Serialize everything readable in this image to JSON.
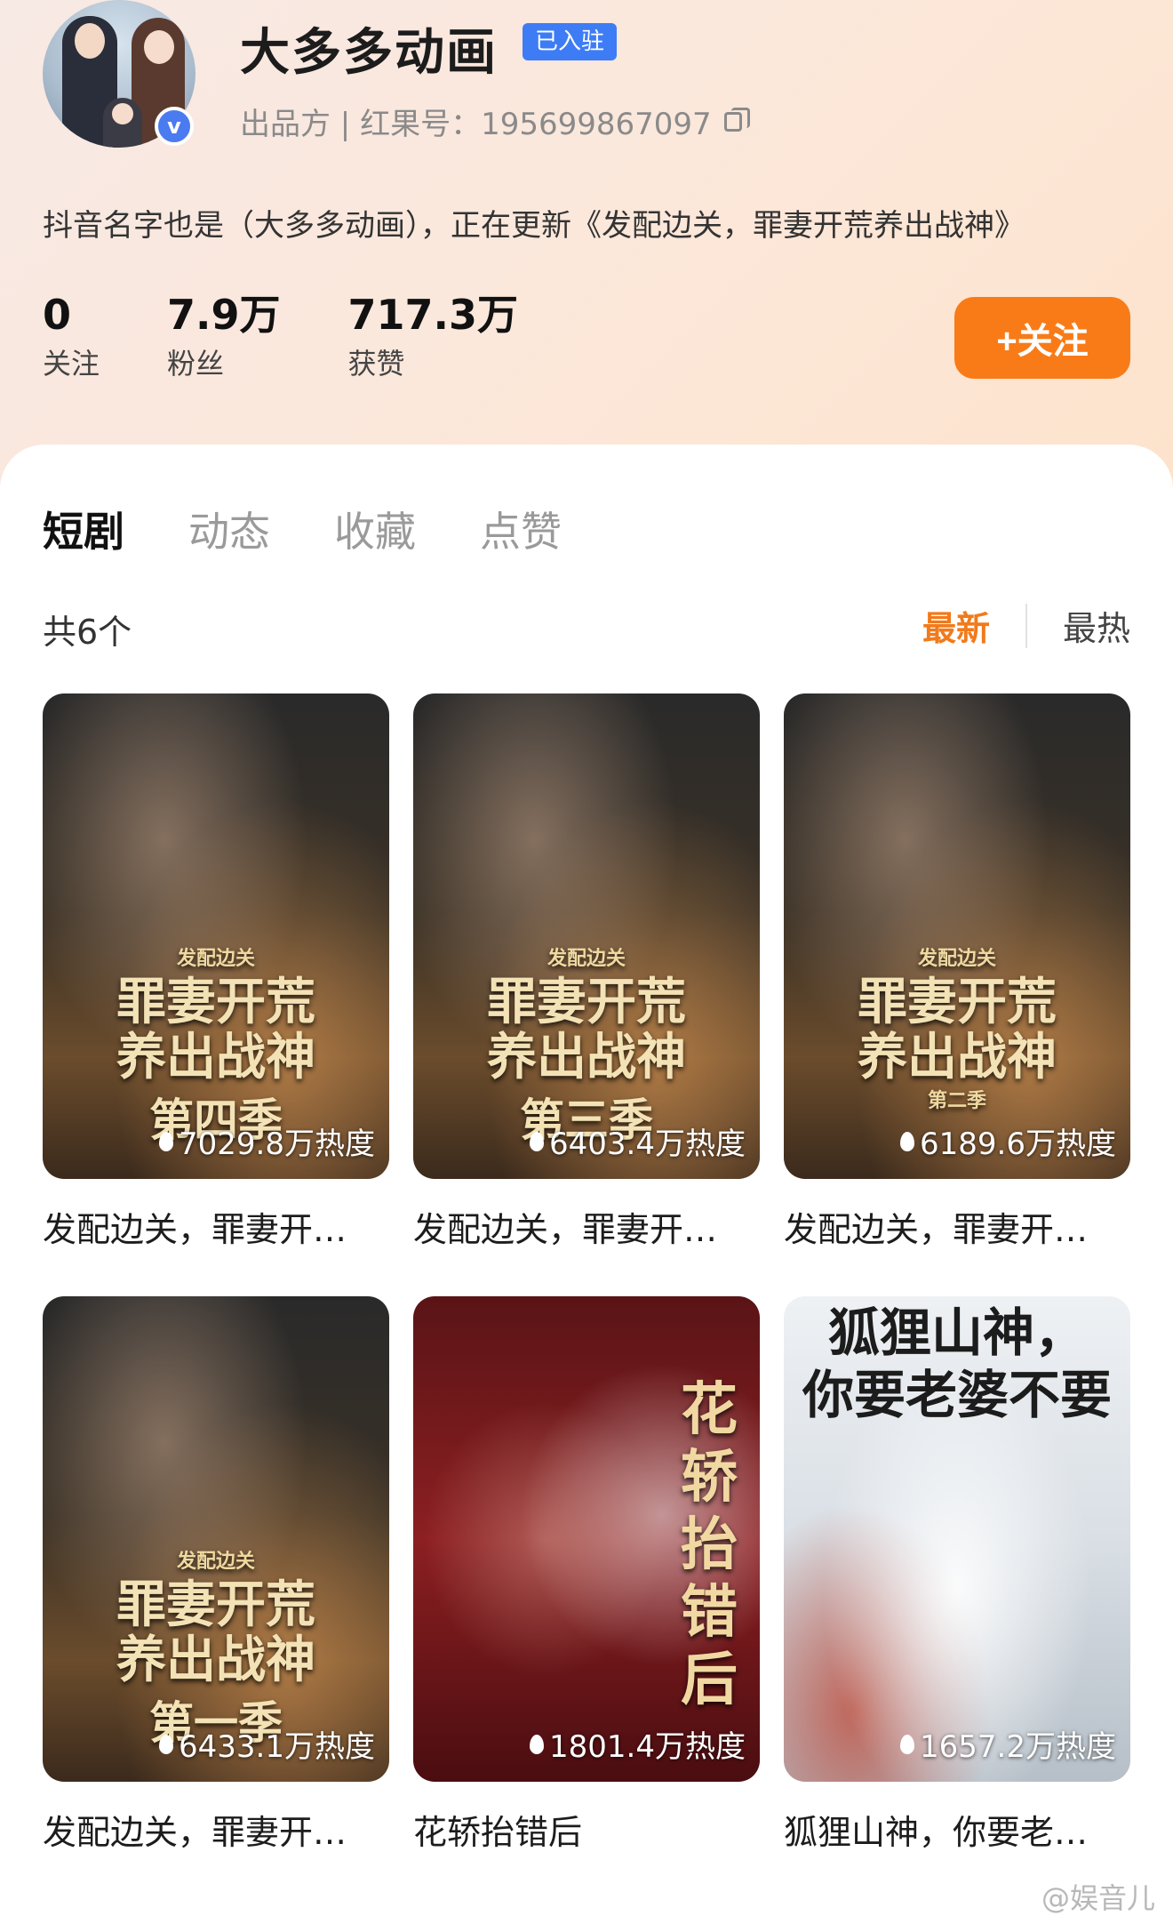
{
  "profile": {
    "name": "大多多动画",
    "settled_badge": "已入驻",
    "meta": "出品方 | 红果号：195699867097",
    "bio": "抖音名字也是（大多多动画），正在更新《发配边关，罪妻开荒养出战神》",
    "verify_icon": "v"
  },
  "stats": [
    {
      "num": "0",
      "label": "关注"
    },
    {
      "num": "7.9万",
      "label": "粉丝"
    },
    {
      "num": "717.3万",
      "label": "获赞"
    }
  ],
  "follow_button": "+关注",
  "tabs": [
    "短剧",
    "动态",
    "收藏",
    "点赞"
  ],
  "count_text": "共6个",
  "sort": {
    "newest": "最新",
    "hottest": "最热"
  },
  "cards": [
    {
      "heat": "7029.8万热度",
      "title": "发配边关，罪妻开…",
      "art_small": "发配边关",
      "art_big": "罪妻开荒",
      "art_big2": "养出战神",
      "art_season": "第四季"
    },
    {
      "heat": "6403.4万热度",
      "title": "发配边关，罪妻开…",
      "art_small": "发配边关",
      "art_big": "罪妻开荒",
      "art_big2": "养出战神",
      "art_season": "第三季"
    },
    {
      "heat": "6189.6万热度",
      "title": "发配边关，罪妻开…",
      "art_small": "发配边关",
      "art_big": "罪妻开荒",
      "art_big2": "养出战神",
      "art_season": "第二季"
    },
    {
      "heat": "6433.1万热度",
      "title": "发配边关，罪妻开…",
      "art_small": "发配边关",
      "art_big": "罪妻开荒",
      "art_big2": "养出战神",
      "art_season": "第一季"
    },
    {
      "heat": "1801.4万热度",
      "title": "花轿抬错后",
      "art_vertical": "花轿抬错后"
    },
    {
      "heat": "1657.2万热度",
      "title": "狐狸山神，你要老…",
      "art_top1": "狐狸山神，",
      "art_top2": "你要老婆不要"
    }
  ],
  "watermark": "@娱音儿"
}
